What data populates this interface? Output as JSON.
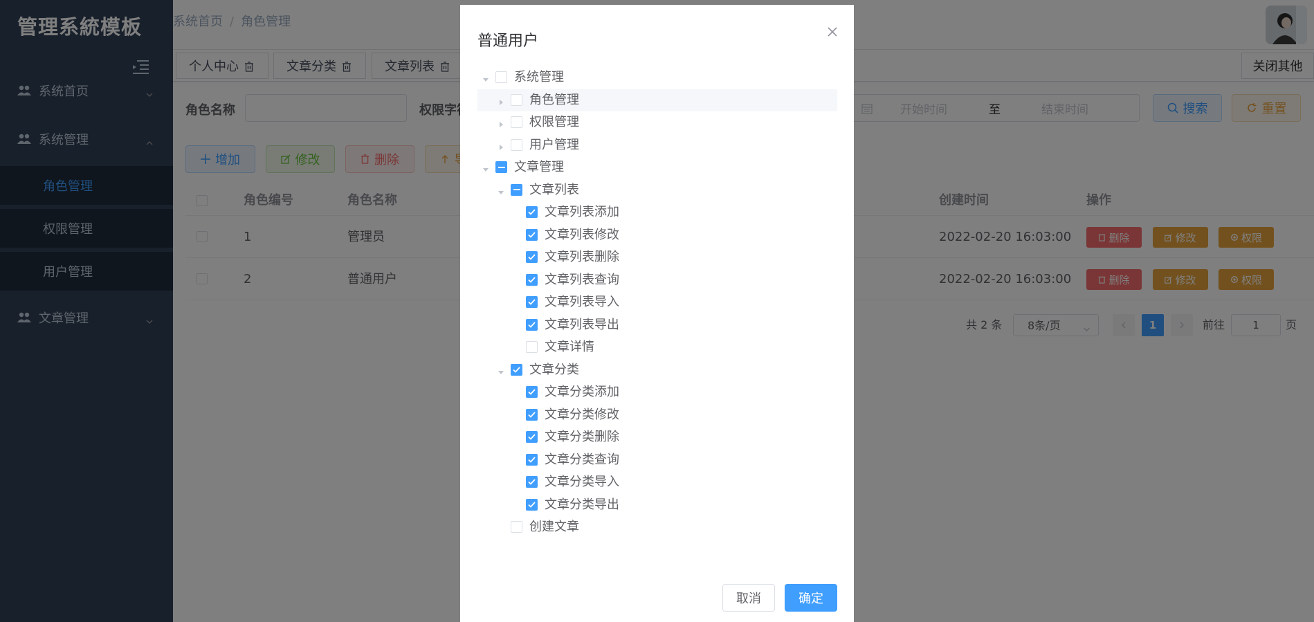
{
  "app": {
    "title": "管理系統模板"
  },
  "colors": {
    "sidebar_bg": "#304156",
    "primary": "#409eff",
    "danger": "#f56c6c",
    "warning": "#e6a23c",
    "success": "#67c23a"
  },
  "sidebar": {
    "menu_icon": "hamburger-icon",
    "items": [
      {
        "label": "系统首页",
        "icon": "users-icon",
        "arrow": "chevron-down-icon"
      },
      {
        "label": "系统管理",
        "icon": "users-icon",
        "arrow": "chevron-up-icon",
        "children": [
          {
            "label": "角色管理",
            "active": true
          },
          {
            "label": "权限管理"
          },
          {
            "label": "用户管理"
          }
        ]
      },
      {
        "label": "文章管理",
        "icon": "users-icon",
        "arrow": "chevron-down-icon"
      }
    ]
  },
  "header": {
    "breadcrumb": [
      "系统首页",
      "角色管理"
    ],
    "separator": "/"
  },
  "tags": {
    "items": [
      "个人中心",
      "文章分类",
      "文章列表"
    ],
    "close_others": "关闭其他"
  },
  "search": {
    "role_name_label": "角色名称",
    "perm_label": "权限字符",
    "start_placeholder": "开始时间",
    "range_sep": "至",
    "end_placeholder": "结束时间",
    "search_button": "搜索",
    "reset_button": "重置"
  },
  "toolbar": {
    "add": "增加",
    "edit": "修改",
    "delete": "删除",
    "export": "导出"
  },
  "table": {
    "headers": {
      "id": "角色编号",
      "name": "角色名称",
      "created": "创建时间",
      "ops": "操作"
    },
    "rows": [
      {
        "id": "1",
        "name": "管理员",
        "created": "2022-02-20 16:03:00"
      },
      {
        "id": "2",
        "name": "普通用户",
        "created": "2022-02-20 16:03:00"
      }
    ],
    "op_labels": {
      "delete": "删除",
      "edit": "修改",
      "perm": "权限"
    }
  },
  "pagination": {
    "total": "共 2 条",
    "page_size": "8条/页",
    "current": "1",
    "goto_label": "前往",
    "goto_value": "1",
    "page_unit": "页"
  },
  "dialog": {
    "title": "普通用户",
    "cancel": "取消",
    "confirm": "确定",
    "tree": [
      {
        "label": "系统管理",
        "level": 0,
        "arrow": "down",
        "state": "unchecked"
      },
      {
        "label": "角色管理",
        "level": 1,
        "arrow": "right",
        "state": "unchecked",
        "hover": true
      },
      {
        "label": "权限管理",
        "level": 1,
        "arrow": "right",
        "state": "unchecked"
      },
      {
        "label": "用户管理",
        "level": 1,
        "arrow": "right",
        "state": "unchecked"
      },
      {
        "label": "文章管理",
        "level": 0,
        "arrow": "down",
        "state": "indeterminate"
      },
      {
        "label": "文章列表",
        "level": 1,
        "arrow": "down",
        "state": "indeterminate"
      },
      {
        "label": "文章列表添加",
        "level": 2,
        "arrow": "none",
        "state": "checked"
      },
      {
        "label": "文章列表修改",
        "level": 2,
        "arrow": "none",
        "state": "checked"
      },
      {
        "label": "文章列表删除",
        "level": 2,
        "arrow": "none",
        "state": "checked"
      },
      {
        "label": "文章列表查询",
        "level": 2,
        "arrow": "none",
        "state": "checked"
      },
      {
        "label": "文章列表导入",
        "level": 2,
        "arrow": "none",
        "state": "checked"
      },
      {
        "label": "文章列表导出",
        "level": 2,
        "arrow": "none",
        "state": "checked"
      },
      {
        "label": "文章详情",
        "level": 2,
        "arrow": "none",
        "state": "unchecked"
      },
      {
        "label": "文章分类",
        "level": 1,
        "arrow": "down",
        "state": "checked"
      },
      {
        "label": "文章分类添加",
        "level": 2,
        "arrow": "none",
        "state": "checked"
      },
      {
        "label": "文章分类修改",
        "level": 2,
        "arrow": "none",
        "state": "checked"
      },
      {
        "label": "文章分类删除",
        "level": 2,
        "arrow": "none",
        "state": "checked"
      },
      {
        "label": "文章分类查询",
        "level": 2,
        "arrow": "none",
        "state": "checked"
      },
      {
        "label": "文章分类导入",
        "level": 2,
        "arrow": "none",
        "state": "checked"
      },
      {
        "label": "文章分类导出",
        "level": 2,
        "arrow": "none",
        "state": "checked"
      },
      {
        "label": "创建文章",
        "level": 1,
        "arrow": "none",
        "state": "unchecked"
      }
    ]
  }
}
